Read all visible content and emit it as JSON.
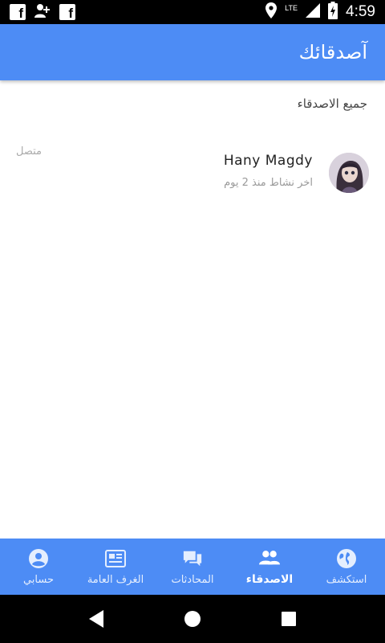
{
  "status_bar": {
    "time": "4:59",
    "network": "LTE",
    "icons": [
      "facebook-icon",
      "add-friend-icon",
      "facebook-icon",
      "location-icon",
      "signal-icon",
      "battery-charging-icon"
    ]
  },
  "app_bar": {
    "title": "آصدقائك",
    "color": "#4d8cf5"
  },
  "section": {
    "title": "جميع الاصدقاء"
  },
  "friends": [
    {
      "name": "Hany Magdy",
      "last_active": "اخر نشاط منذ 2 يوم",
      "status": "متصل"
    }
  ],
  "bottom_nav": {
    "items": [
      {
        "label": "استكشف",
        "icon": "globe-icon",
        "active": false
      },
      {
        "label": "الاصدقاء",
        "icon": "people-icon",
        "active": true
      },
      {
        "label": "المحادثات",
        "icon": "chat-icon",
        "active": false
      },
      {
        "label": "الغرف العامة",
        "icon": "newspaper-icon",
        "active": false
      },
      {
        "label": "حسابي",
        "icon": "account-icon",
        "active": false
      }
    ]
  },
  "system_nav": {
    "icons": [
      "back-icon",
      "home-icon",
      "recents-icon"
    ]
  }
}
